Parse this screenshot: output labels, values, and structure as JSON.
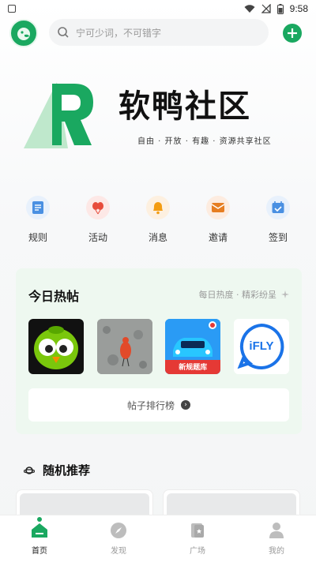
{
  "status_bar": {
    "time": "9:58"
  },
  "header": {
    "search_placeholder": "宁可少词，不可错字"
  },
  "banner": {
    "brand_name": "软鸭社区",
    "tagline": "自由 · 开放 · 有趣 · 资源共享社区"
  },
  "quick_menu": [
    {
      "label": "规则",
      "icon": "rules-doc-icon",
      "color": "#4a90e2"
    },
    {
      "label": "活动",
      "icon": "balloon-icon",
      "color": "#e74c3c"
    },
    {
      "label": "消息",
      "icon": "bell-icon",
      "color": "#f39c12"
    },
    {
      "label": "邀请",
      "icon": "mail-icon",
      "color": "#e67e22"
    },
    {
      "label": "签到",
      "icon": "calendar-check-icon",
      "color": "#4a90e2"
    }
  ],
  "hot_posts": {
    "title": "今日热帖",
    "subtitle": "每日热度 · 精彩纷呈",
    "items": [
      {
        "name": "duolingo-thumb"
      },
      {
        "name": "bird-thumb"
      },
      {
        "name": "car-app-thumb",
        "badge": "新规题库"
      },
      {
        "name": "ifly-thumb",
        "text": "iFLY"
      }
    ],
    "rank_button": "帖子排行榜"
  },
  "random": {
    "title": "随机推荐"
  },
  "bottom_nav": [
    {
      "label": "首页",
      "active": true
    },
    {
      "label": "发现",
      "active": false
    },
    {
      "label": "广场",
      "active": false
    },
    {
      "label": "我的",
      "active": false
    }
  ],
  "colors": {
    "brand_green": "#1aa860",
    "light_green": "#eef8f0"
  }
}
